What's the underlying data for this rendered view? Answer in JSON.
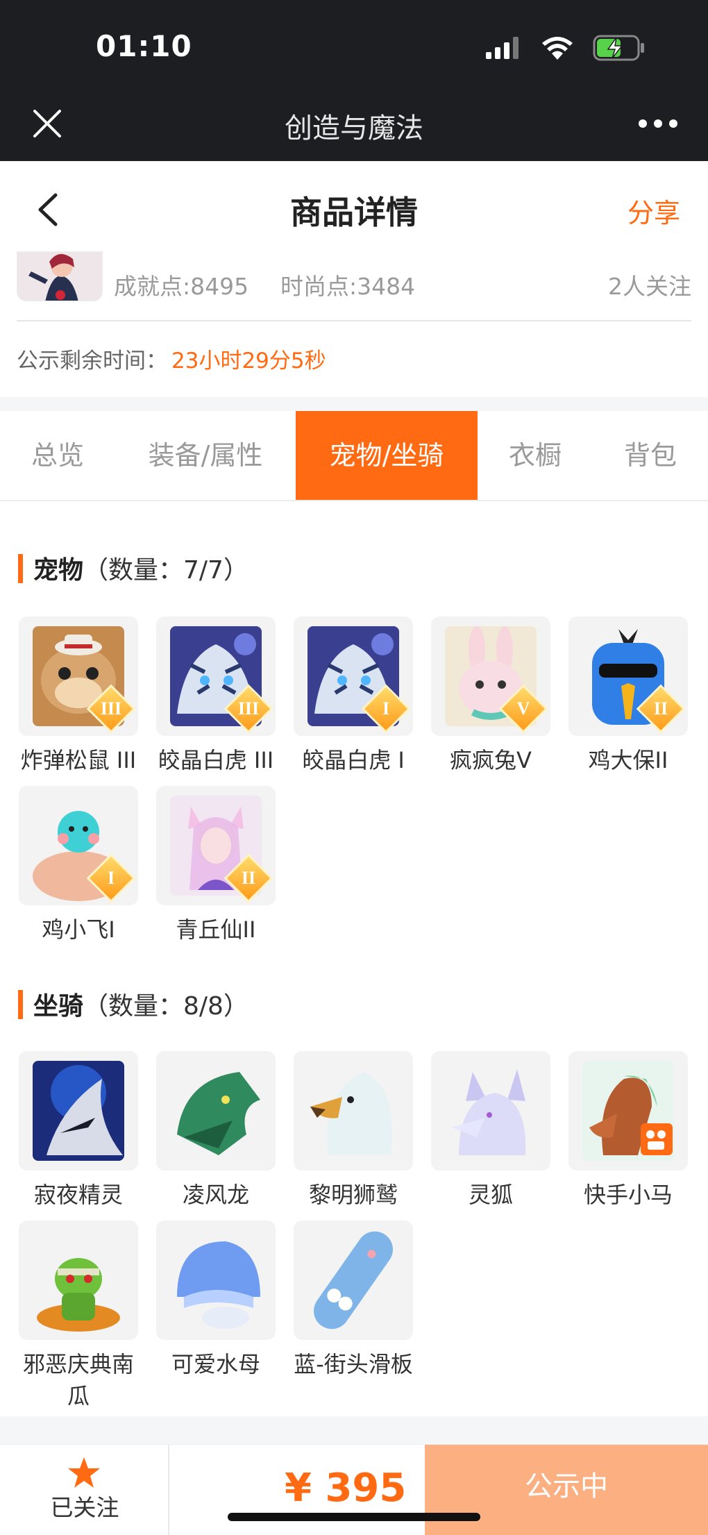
{
  "status_bar": {
    "time": "01:10"
  },
  "title_bar": {
    "title": "创造与魔法"
  },
  "header": {
    "title": "商品详情",
    "share": "分享"
  },
  "summary": {
    "achievement": "成就点:8495",
    "fashion": "时尚点:3484",
    "followers": "2人关注",
    "remaining_label": "公示剩余时间：",
    "remaining_value": "23小时29分5秒"
  },
  "tabs": [
    {
      "label": "总览"
    },
    {
      "label": "装备/属性"
    },
    {
      "label": "宠物/坐骑",
      "active": true
    },
    {
      "label": "衣橱"
    },
    {
      "label": "背包"
    }
  ],
  "pets": {
    "title": "宠物",
    "count": "（数量：7/7）",
    "items": [
      {
        "name": "炸弹松鼠 III",
        "badge": "III",
        "icon": "squirrel-icon"
      },
      {
        "name": "皎晶白虎 III",
        "badge": "III",
        "icon": "white-tiger-icon"
      },
      {
        "name": "皎晶白虎 I",
        "badge": "I",
        "icon": "white-tiger-icon"
      },
      {
        "name": "疯疯兔V",
        "badge": "V",
        "icon": "rabbit-icon"
      },
      {
        "name": "鸡大保II",
        "badge": "II",
        "icon": "blue-bird-icon"
      },
      {
        "name": "鸡小飞I",
        "badge": "I",
        "icon": "muscle-bird-icon"
      },
      {
        "name": "青丘仙II",
        "badge": "II",
        "icon": "fox-fairy-icon"
      }
    ]
  },
  "mounts": {
    "title": "坐骑",
    "count": "（数量：8/8）",
    "items": [
      {
        "name": "寂夜精灵",
        "icon": "night-spirit-icon"
      },
      {
        "name": "凌风龙",
        "icon": "wind-dragon-icon"
      },
      {
        "name": "黎明狮鹫",
        "icon": "griffin-icon"
      },
      {
        "name": "灵狐",
        "icon": "spirit-fox-icon"
      },
      {
        "name": "快手小马",
        "icon": "pony-icon"
      },
      {
        "name": "邪恶庆典南瓜",
        "icon": "pumpkin-icon"
      },
      {
        "name": "可爱水母",
        "icon": "jellyfish-icon"
      },
      {
        "name": "蓝-街头滑板",
        "icon": "skateboard-icon"
      }
    ]
  },
  "bottom_bar": {
    "follow_label": "已关注",
    "price": "¥ 395",
    "status_button": "公示中"
  },
  "colors": {
    "accent": "#ff6a12",
    "status_button": "#fcaf80",
    "top_bar": "#1d1e21"
  }
}
